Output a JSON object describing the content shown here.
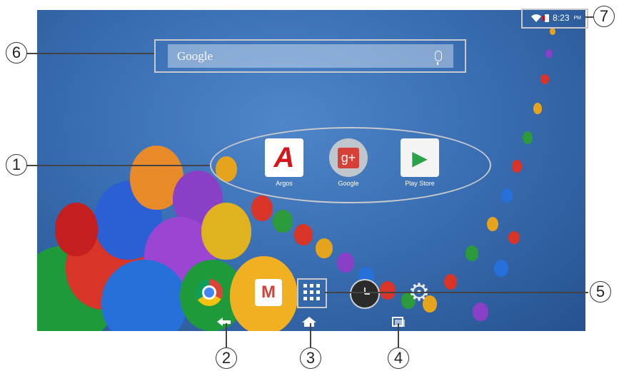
{
  "status_bar": {
    "time": "8:23",
    "ampm": "PM"
  },
  "search": {
    "label": "Google"
  },
  "apps": [
    {
      "label": "Argos",
      "icon": "argos-icon",
      "glyph": "A"
    },
    {
      "label": "Google",
      "icon": "google-plus-icon",
      "glyph": "g+"
    },
    {
      "label": "Play Store",
      "icon": "play-store-icon",
      "glyph": "▶"
    }
  ],
  "dock": [
    {
      "icon": "chrome-icon"
    },
    {
      "icon": "gmail-icon",
      "glyph": "M"
    },
    {
      "icon": "app-drawer-icon"
    },
    {
      "icon": "clock-icon"
    },
    {
      "icon": "settings-icon",
      "glyph": "⚙"
    }
  ],
  "nav": [
    {
      "icon": "back-icon"
    },
    {
      "icon": "home-icon"
    },
    {
      "icon": "recent-apps-icon"
    }
  ],
  "callouts": [
    "1",
    "2",
    "3",
    "4",
    "5",
    "6",
    "7"
  ],
  "colors": {
    "wallpaper": "#3a6fb3",
    "callout_outline": "#c7c9cc"
  }
}
